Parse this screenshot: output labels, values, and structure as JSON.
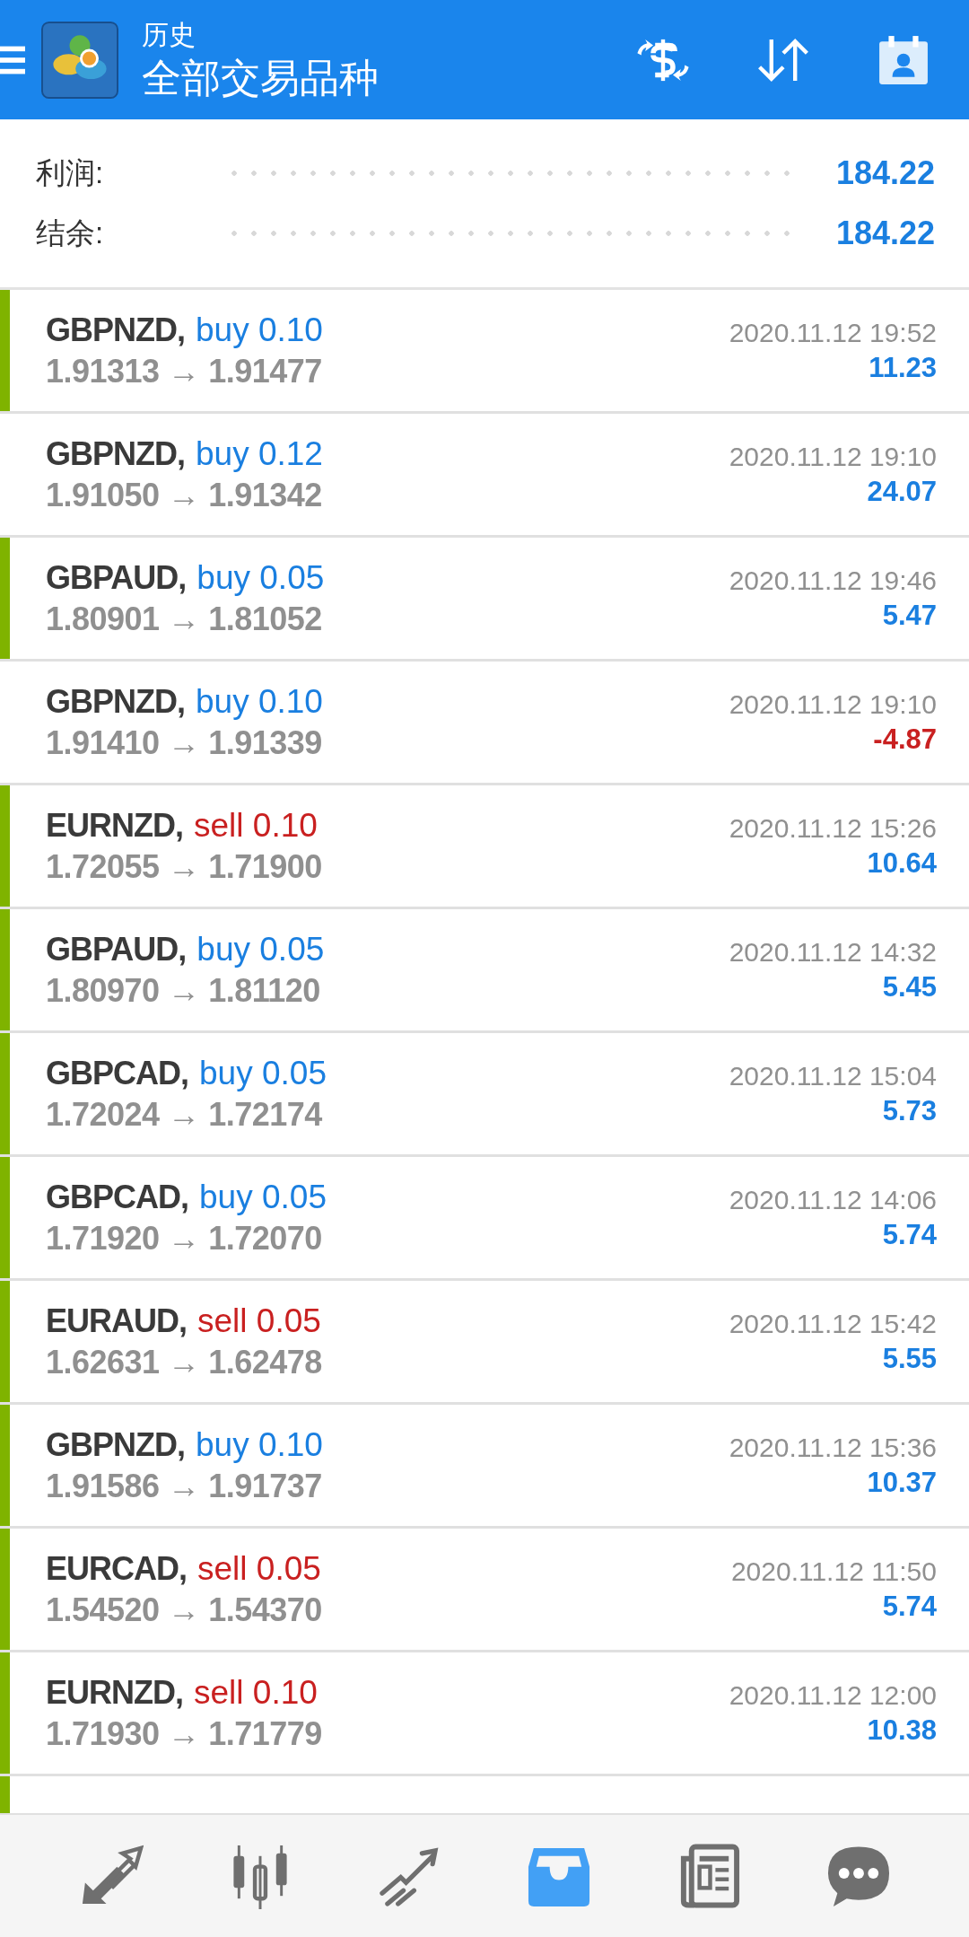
{
  "header": {
    "subtitle": "历史",
    "title": "全部交易品种"
  },
  "summary": [
    {
      "label": "利润:",
      "value": "184.22"
    },
    {
      "label": "结余:",
      "value": "184.22"
    }
  ],
  "trades": [
    {
      "symbol": "GBPNZD,",
      "kind": "buy",
      "type": "buy 0.10",
      "prices": "1.91313 → 1.91477",
      "time": "2020.11.12 19:52",
      "profit": "11.23",
      "loss": false,
      "marker": true
    },
    {
      "symbol": "GBPNZD,",
      "kind": "buy",
      "type": "buy 0.12",
      "prices": "1.91050 → 1.91342",
      "time": "2020.11.12 19:10",
      "profit": "24.07",
      "loss": false,
      "marker": false
    },
    {
      "symbol": "GBPAUD,",
      "kind": "buy",
      "type": "buy 0.05",
      "prices": "1.80901 → 1.81052",
      "time": "2020.11.12 19:46",
      "profit": "5.47",
      "loss": false,
      "marker": true
    },
    {
      "symbol": "GBPNZD,",
      "kind": "buy",
      "type": "buy 0.10",
      "prices": "1.91410 → 1.91339",
      "time": "2020.11.12 19:10",
      "profit": "-4.87",
      "loss": true,
      "marker": false
    },
    {
      "symbol": "EURNZD,",
      "kind": "sell",
      "type": "sell 0.10",
      "prices": "1.72055 → 1.71900",
      "time": "2020.11.12 15:26",
      "profit": "10.64",
      "loss": false,
      "marker": true
    },
    {
      "symbol": "GBPAUD,",
      "kind": "buy",
      "type": "buy 0.05",
      "prices": "1.80970 → 1.81120",
      "time": "2020.11.12 14:32",
      "profit": "5.45",
      "loss": false,
      "marker": true
    },
    {
      "symbol": "GBPCAD,",
      "kind": "buy",
      "type": "buy 0.05",
      "prices": "1.72024 → 1.72174",
      "time": "2020.11.12 15:04",
      "profit": "5.73",
      "loss": false,
      "marker": true
    },
    {
      "symbol": "GBPCAD,",
      "kind": "buy",
      "type": "buy 0.05",
      "prices": "1.71920 → 1.72070",
      "time": "2020.11.12 14:06",
      "profit": "5.74",
      "loss": false,
      "marker": true
    },
    {
      "symbol": "EURAUD,",
      "kind": "sell",
      "type": "sell 0.05",
      "prices": "1.62631 → 1.62478",
      "time": "2020.11.12 15:42",
      "profit": "5.55",
      "loss": false,
      "marker": true
    },
    {
      "symbol": "GBPNZD,",
      "kind": "buy",
      "type": "buy 0.10",
      "prices": "1.91586 → 1.91737",
      "time": "2020.11.12 15:36",
      "profit": "10.37",
      "loss": false,
      "marker": true
    },
    {
      "symbol": "EURCAD,",
      "kind": "sell",
      "type": "sell 0.05",
      "prices": "1.54520 → 1.54370",
      "time": "2020.11.12 11:50",
      "profit": "5.74",
      "loss": false,
      "marker": true
    },
    {
      "symbol": "EURNZD,",
      "kind": "sell",
      "type": "sell 0.10",
      "prices": "1.71930 → 1.71779",
      "time": "2020.11.12 12:00",
      "profit": "10.38",
      "loss": false,
      "marker": true
    },
    {
      "marker": true
    }
  ],
  "nav": [
    {
      "kind": "trade",
      "selected": false
    },
    {
      "kind": "quotes",
      "selected": false
    },
    {
      "kind": "chart",
      "selected": false
    },
    {
      "kind": "history",
      "selected": true
    },
    {
      "kind": "news",
      "selected": false
    },
    {
      "kind": "chat",
      "selected": false
    }
  ]
}
